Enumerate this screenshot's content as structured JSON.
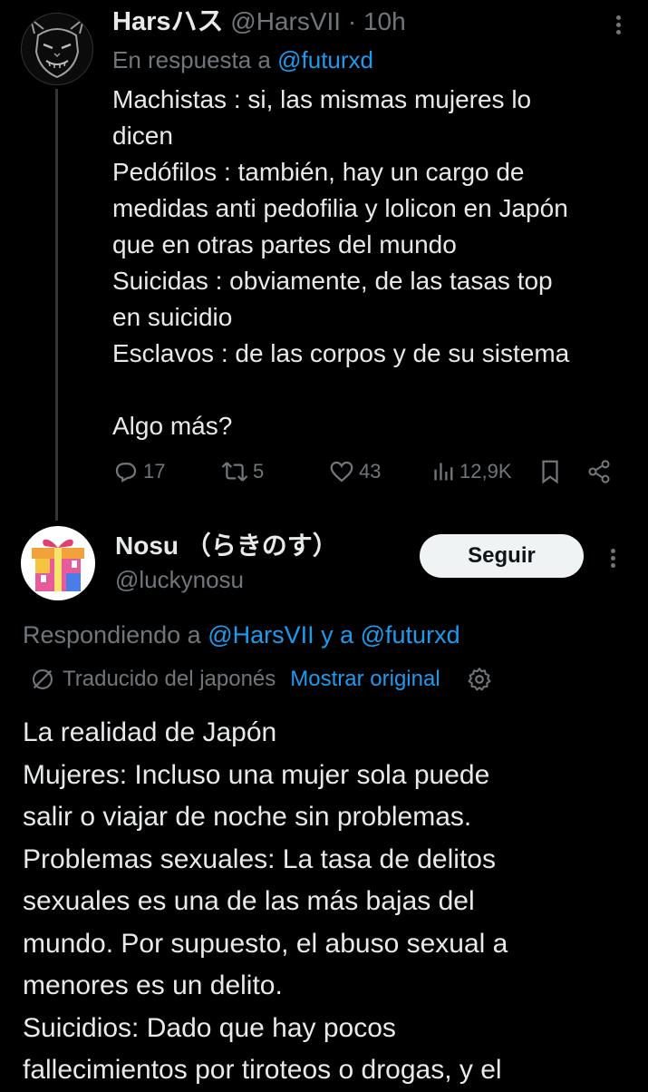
{
  "tweet1": {
    "display_name": "Harsハス",
    "handle": "@HarsVII",
    "time": "· 10h",
    "reply_prefix": "En respuesta a",
    "reply_to": "@futurxd",
    "lines": [
      "Machistas : si, las mismas mujeres lo",
      "dicen",
      "Pedófilos : también, hay un cargo de",
      "medidas anti pedofilia y lolicon en Japón",
      "que en otras partes del mundo",
      "Suicidas : obviamente, de las tasas top",
      "en suicidio",
      "Esclavos : de las corpos y de su sistema",
      "",
      "Algo más?"
    ],
    "actions": {
      "replies": "17",
      "retweets": "5",
      "likes": "43",
      "views": "12,9K"
    }
  },
  "tweet2": {
    "display_name": "Nosu （らきのす）",
    "handle": "@luckynosu",
    "follow_label": "Seguir",
    "reply_prefix": "Respondiendo a",
    "reply_to": "@HarsVII y a @futurxd",
    "translated_label": "Traducido del japonés",
    "show_original": "Mostrar original",
    "lines": [
      "La realidad de Japón",
      "Mujeres: Incluso una mujer sola puede",
      "salir o viajar de noche sin problemas.",
      "Problemas sexuales: La tasa de delitos",
      "sexuales es una de las más bajas del",
      "mundo. Por supuesto, el abuso sexual a",
      "menores es un delito.",
      "Suicidios: Dado que hay pocos",
      "fallecimientos por tiroteos o drogas, y el"
    ]
  },
  "icons": [
    "oni-mask-avatar",
    "gift-avatar",
    "more-icon",
    "reply-icon",
    "retweet-icon",
    "like-icon",
    "views-icon",
    "bookmark-icon",
    "share-icon",
    "translate-icon",
    "gear-icon"
  ],
  "colors": {
    "background": "#000000",
    "text": "#e7e9ea",
    "muted": "#71767b",
    "link": "#1d9bf0",
    "button": "#eff3f4"
  }
}
